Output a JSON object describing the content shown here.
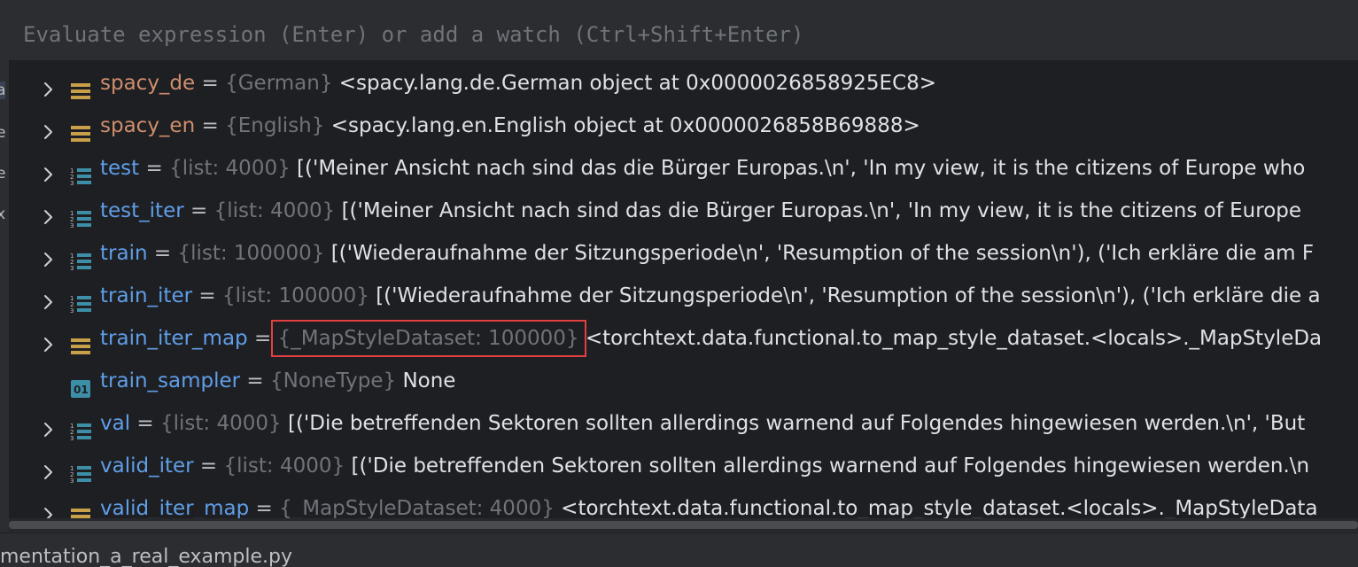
{
  "left_gutter": [
    "a",
    "e",
    "e",
    "x"
  ],
  "evaluate": {
    "placeholder": "Evaluate expression (Enter) or add a watch (Ctrl+Shift+Enter)"
  },
  "variables": [
    {
      "name": "spacy_de",
      "type": "{German}",
      "value": "<spacy.lang.de.German object at 0x0000026858925EC8>",
      "icon": "object-icon",
      "expandable": true,
      "name_color": "orange"
    },
    {
      "name": "spacy_en",
      "type": "{English}",
      "value": "<spacy.lang.en.English object at 0x0000026858B69888>",
      "icon": "object-icon",
      "expandable": true,
      "name_color": "orange"
    },
    {
      "name": "test",
      "type": "{list: 4000}",
      "value": "[('Meiner Ansicht nach sind das die Bürger Europas.\\n', 'In my view, it is the citizens of Europe who",
      "icon": "list-icon",
      "expandable": true
    },
    {
      "name": "test_iter",
      "type": "{list: 4000}",
      "value": "[('Meiner Ansicht nach sind das die Bürger Europas.\\n', 'In my view, it is the citizens of Europe",
      "icon": "list-icon",
      "expandable": true
    },
    {
      "name": "train",
      "type": "{list: 100000}",
      "value": "[('Wiederaufnahme der Sitzungsperiode\\n', 'Resumption of the session\\n'), ('Ich erkläre die am F",
      "icon": "list-icon",
      "expandable": true
    },
    {
      "name": "train_iter",
      "type": "{list: 100000}",
      "value": "[('Wiederaufnahme der Sitzungsperiode\\n', 'Resumption of the session\\n'), ('Ich erkläre die a",
      "icon": "list-icon",
      "expandable": true
    },
    {
      "name": "train_iter_map",
      "type": "{_MapStyleDataset: 100000}",
      "value": "<torchtext.data.functional.to_map_style_dataset.<locals>._MapStyleDa",
      "icon": "object-icon",
      "expandable": true,
      "highlighted": true
    },
    {
      "name": "train_sampler",
      "type": "{NoneType}",
      "value": "None",
      "icon": "primitive-icon",
      "expandable": false
    },
    {
      "name": "val",
      "type": "{list: 4000}",
      "value": "[('Die betreffenden Sektoren sollten allerdings warnend auf Folgendes hingewiesen werden.\\n', 'But",
      "icon": "list-icon",
      "expandable": true
    },
    {
      "name": "valid_iter",
      "type": "{list: 4000}",
      "value": "[('Die betreffenden Sektoren sollten allerdings warnend auf Folgendes hingewiesen werden.\\n",
      "icon": "list-icon",
      "expandable": true
    },
    {
      "name": "valid_iter_map",
      "type": "{_MapStyleDataset: 4000}",
      "value": "<torchtext.data.functional.to_map_style_dataset.<locals>._MapStyleData",
      "icon": "object-icon",
      "expandable": true
    }
  ],
  "bottom": {
    "file_label": "mentation_a_real_example.py"
  },
  "colors": {
    "panel_bg": "#1e1f22",
    "chrome_bg": "#2b2d30",
    "name_blue": "#5f9ee8",
    "name_orange": "#cf8e6d",
    "type_gray": "#6f737a",
    "value_white": "#dfe1e5",
    "highlight_red": "#e04040",
    "icon_yellow": "#c9a04a",
    "icon_teal": "#3d8fa8"
  }
}
